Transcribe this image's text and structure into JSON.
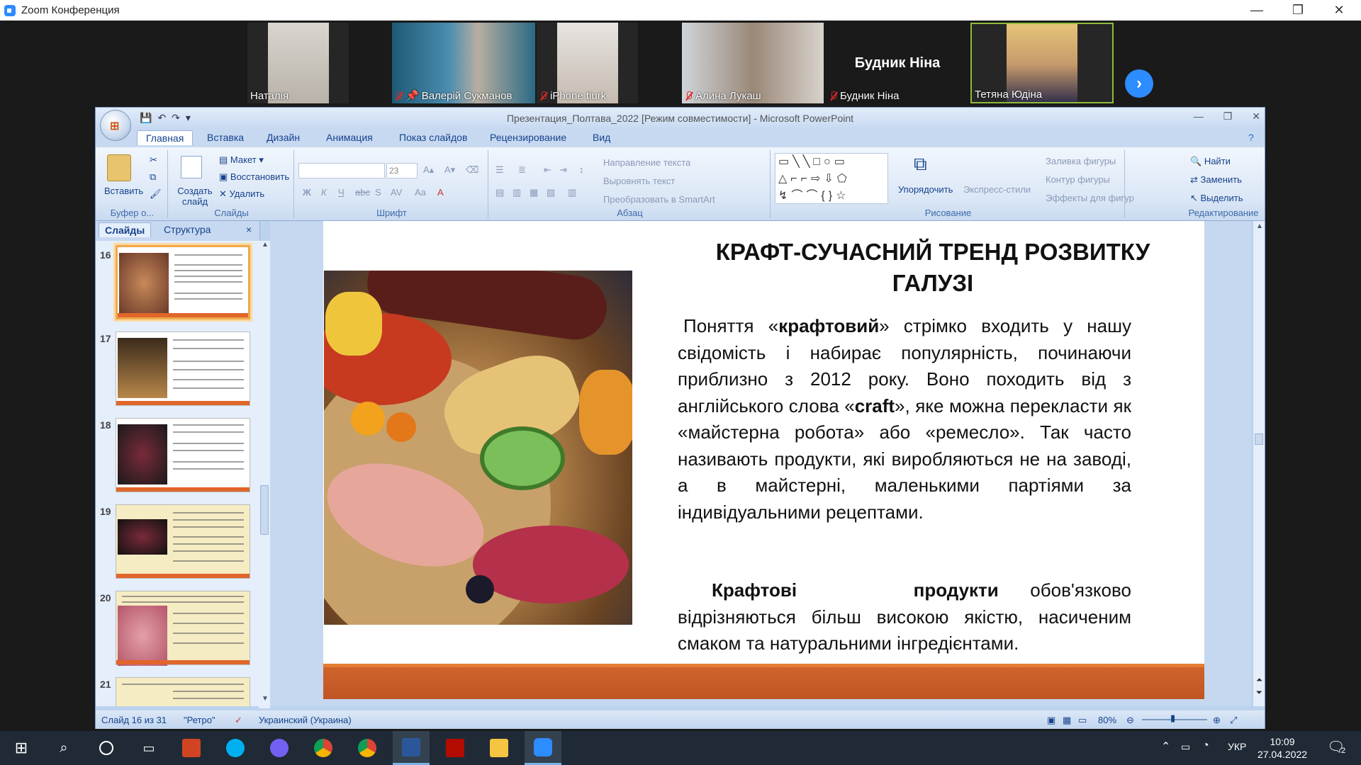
{
  "window": {
    "title": "Zoom Конференция",
    "min": "—",
    "max": "❐",
    "close": "✕"
  },
  "participants": [
    {
      "name": "Наталія",
      "muted": false
    },
    {
      "name": "Валерій Сукманов",
      "muted": true,
      "pinned": true
    },
    {
      "name": "iPhone tiurk",
      "muted": true
    },
    {
      "name": "Алина Лукаш",
      "muted": true
    },
    {
      "name": "Будник Ніна",
      "muted": true,
      "label": "Будник Ніна"
    },
    {
      "name": "Тетяна Юдіна",
      "muted": false
    }
  ],
  "raise_hand_icon": "✋",
  "next_icon": "›",
  "ppt": {
    "title": "Презентация_Полтава_2022 [Режим совместимости] - Microsoft PowerPoint",
    "tabs": [
      "Главная",
      "Вставка",
      "Дизайн",
      "Анимация",
      "Показ слайдов",
      "Рецензирование",
      "Вид"
    ],
    "ribbon": {
      "paste": "Вставить",
      "clipboard": "Буфер о...",
      "new_slide": "Создать слайд",
      "layout": "Макет",
      "reset": "Восстановить",
      "delete": "Удалить",
      "slides_group": "Слайды",
      "font_size": "23",
      "font_group": "Шрифт",
      "text_direction": "Направление текста",
      "align_text": "Выровнять текст",
      "smartart": "Преобразовать в SmartArt",
      "paragraph_group": "Абзац",
      "arrange": "Упорядочить",
      "quick_styles": "Экспресс-стили",
      "shape_fill": "Заливка фигуры",
      "shape_outline": "Контур фигуры",
      "shape_effects": "Эффекты для фигур",
      "drawing_group": "Рисование",
      "find": "Найти",
      "replace": "Заменить",
      "select": "Выделить",
      "editing_group": "Редактирование"
    },
    "panel_tabs": [
      "Слайды",
      "Структура"
    ],
    "panel_close": "×",
    "thumbs": [
      "16",
      "17",
      "18",
      "19",
      "20",
      "21"
    ],
    "slide": {
      "title": "КРАФТ-СУЧАСНИЙ ТРЕНД РОЗВИТКУ ГАЛУЗІ",
      "p1_a": "Поняття «",
      "p1_b": "крафтовий",
      "p1_c": "» стрімко входить у нашу свідомість і набирає популярність, починаючи приблизно з 2012 року. Воно походить від з англійського слова «",
      "p1_d": "craft",
      "p1_e": "», яке можна перекласти як «майстерна робота» або «ремесло». Так часто називають продукти, які виробляються не на заводі, а в майстерні, маленькими партіями за індивідуальними рецептами.",
      "p2_a": "Крафтові продукти",
      "p2_b": " обов'язково відрізняються більш високою якістю, насиченим смаком та натуральними інгредієнтами."
    },
    "status": {
      "slide": "Слайд 16 из 31",
      "theme": "\"Ретро\"",
      "lang": "Украинский (Украина)",
      "zoom": "80%"
    }
  },
  "taskbar": {
    "time": "10:09",
    "date": "27.04.2022",
    "lang": "УКР",
    "notif": "2"
  }
}
